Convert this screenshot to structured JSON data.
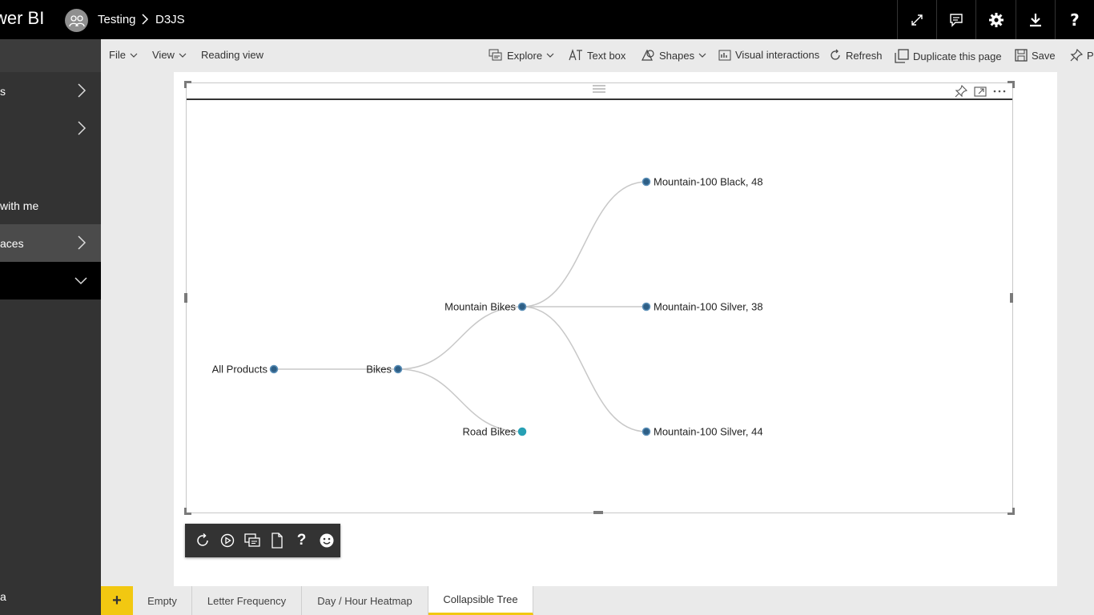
{
  "app": {
    "brand": "wer BI"
  },
  "breadcrumb": {
    "workspace": "Testing",
    "separator": "›",
    "report": "D3JS"
  },
  "topbar_icons": [
    "expand-icon",
    "comment-icon",
    "gear-icon",
    "download-icon",
    "help-icon"
  ],
  "topbar_help_label": "?",
  "leftnav": {
    "items": [
      {
        "label": "s",
        "chevron": "right"
      },
      {
        "label": "",
        "chevron": "right"
      },
      {
        "label": "with me",
        "chevron": ""
      },
      {
        "label": "aces",
        "chevron": "right"
      },
      {
        "label": "",
        "chevron": "down"
      }
    ],
    "bottom": "a"
  },
  "toolbar": {
    "file": "File",
    "view": "View",
    "reading_view": "Reading view",
    "explore": "Explore",
    "text_box": "Text box",
    "shapes": "Shapes",
    "visual_interactions": "Visual interactions",
    "refresh": "Refresh",
    "duplicate": "Duplicate this page",
    "save": "Save",
    "pin": "P"
  },
  "tree": {
    "nodes": [
      {
        "id": "root",
        "label": "All Products",
        "label_side": "left",
        "color": "#2e5f86"
      },
      {
        "id": "bikes",
        "label": "Bikes",
        "label_side": "left",
        "color": "#2e5f86"
      },
      {
        "id": "mountain",
        "label": "Mountain Bikes",
        "label_side": "left",
        "color": "#2e5f86"
      },
      {
        "id": "road",
        "label": "Road Bikes",
        "label_side": "left",
        "color": "#27a0b4"
      },
      {
        "id": "mb48",
        "label": "Mountain-100 Black, 48",
        "label_side": "right",
        "color": "#2e5f86"
      },
      {
        "id": "ms38",
        "label": "Mountain-100 Silver, 38",
        "label_side": "right",
        "color": "#2e5f86"
      },
      {
        "id": "ms44",
        "label": "Mountain-100 Silver, 44",
        "label_side": "right",
        "color": "#2e5f86"
      }
    ],
    "links": [
      [
        "root",
        "bikes"
      ],
      [
        "bikes",
        "mountain"
      ],
      [
        "bikes",
        "road"
      ],
      [
        "mountain",
        "mb48"
      ],
      [
        "mountain",
        "ms38"
      ],
      [
        "mountain",
        "ms44"
      ]
    ]
  },
  "devbar": {
    "icons": [
      "refresh-icon",
      "play-icon",
      "comment-icon",
      "document-icon",
      "help-icon",
      "smiley-icon"
    ],
    "help_label": "?"
  },
  "tabs": {
    "add": "+",
    "items": [
      "Empty",
      "Letter Frequency",
      "Day / Hour Heatmap",
      "Collapsible Tree"
    ],
    "active_index": 3,
    "accent": "#f2c811"
  }
}
